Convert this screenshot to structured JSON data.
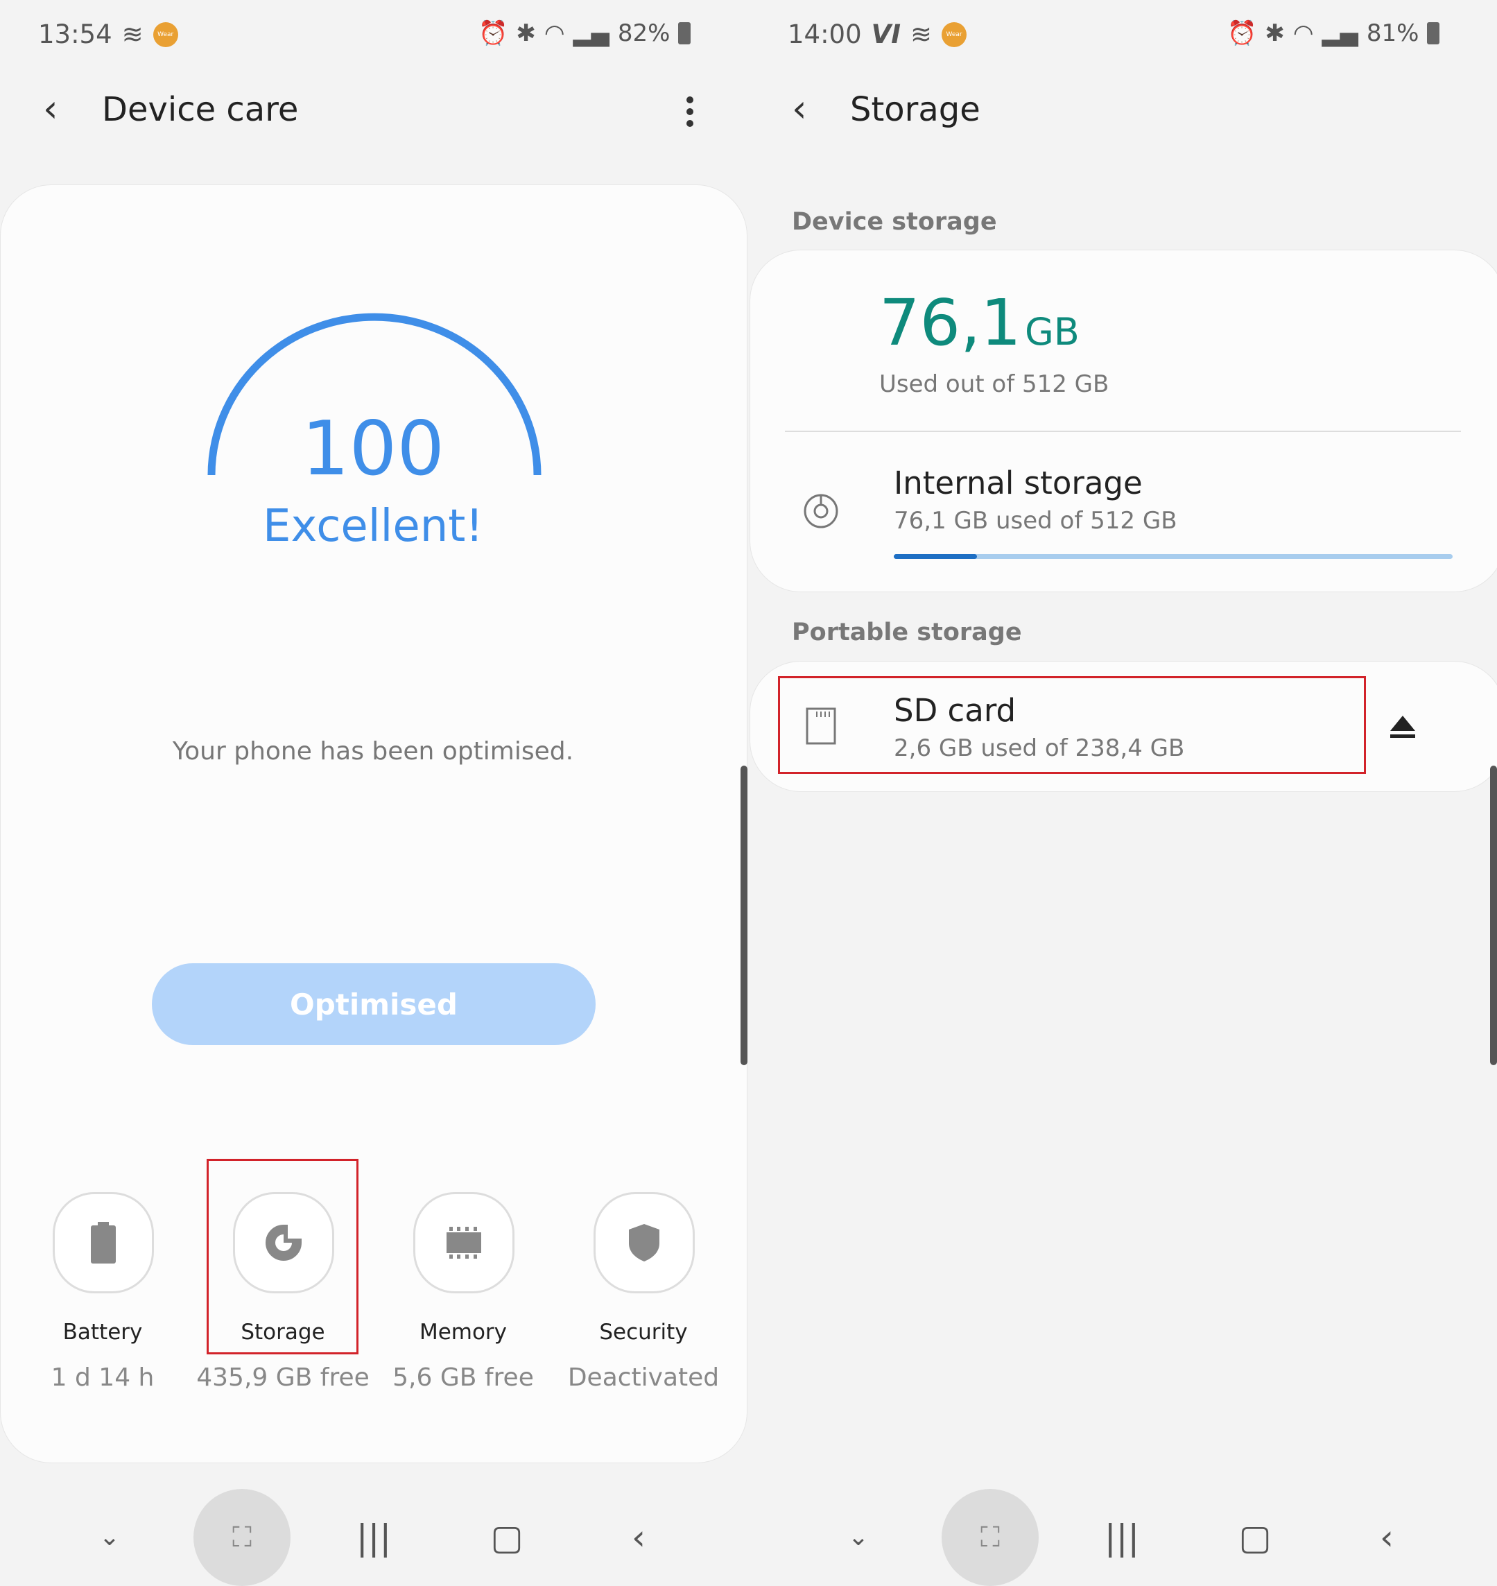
{
  "left": {
    "status": {
      "time": "13:54",
      "wear": "Wear",
      "battery": "82%"
    },
    "header": {
      "title": "Device care",
      "back_icon": "back-arrow-icon",
      "menu_icon": "more-vert-icon"
    },
    "score": {
      "value": "100",
      "rating": "Excellent!",
      "progress_percent": 100
    },
    "message": "Your phone has been optimised.",
    "button": "Optimised",
    "items": [
      {
        "label": "Battery",
        "value": "1 d 14 h",
        "icon": "battery-icon"
      },
      {
        "label": "Storage",
        "value": "435,9 GB free",
        "icon": "storage-pie-icon"
      },
      {
        "label": "Memory",
        "value": "5,6 GB free",
        "icon": "memory-chip-icon"
      },
      {
        "label": "Security",
        "value": "Deactivated",
        "icon": "shield-icon"
      }
    ]
  },
  "right": {
    "status": {
      "time": "14:00",
      "wear": "Wear",
      "battery": "81%"
    },
    "header": {
      "title": "Storage"
    },
    "device_storage": {
      "section": "Device storage",
      "used": "76,1",
      "unit": "GB",
      "caption": "Used out of 512 GB",
      "internal": {
        "title": "Internal storage",
        "subtitle": "76,1 GB used of 512 GB",
        "used_fraction": 0.149
      }
    },
    "portable_storage": {
      "section": "Portable storage",
      "sd": {
        "title": "SD card",
        "subtitle": "2,6 GB used of 238,4 GB"
      }
    }
  },
  "colors": {
    "accent": "#3f8ee8",
    "green": "#0e8a7c",
    "button": "#b3d4fa",
    "highlight": "#d2232a",
    "bar_fill": "#1e6fc4",
    "bar_track": "#a8cdee"
  }
}
